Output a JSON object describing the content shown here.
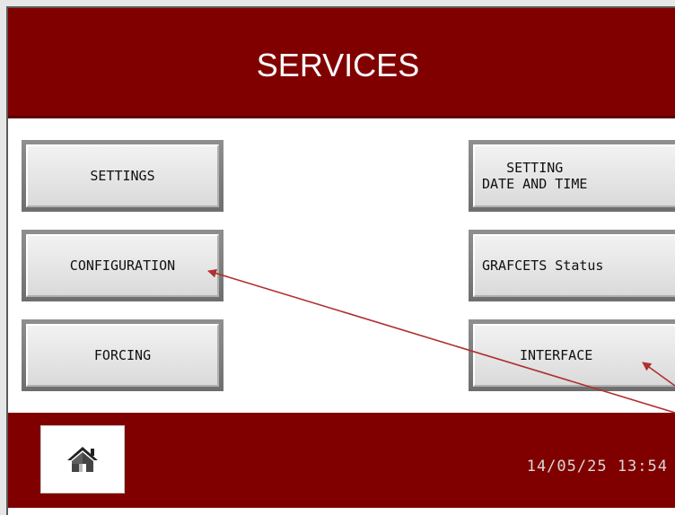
{
  "header": {
    "title": "SERVICES"
  },
  "buttons": {
    "settings": "SETTINGS",
    "configuration": "CONFIGURATION",
    "forcing": "FORCING",
    "setting_date_time": "SETTING\nDATE AND TIME",
    "grafcets_status": "GRAFCETS Status",
    "interface": "INTERFACE"
  },
  "footer": {
    "home_icon": "home-icon",
    "datetime": "14/05/25 13:54"
  },
  "colors": {
    "banner": "#800000",
    "annotation_arrow": "#b03030"
  }
}
